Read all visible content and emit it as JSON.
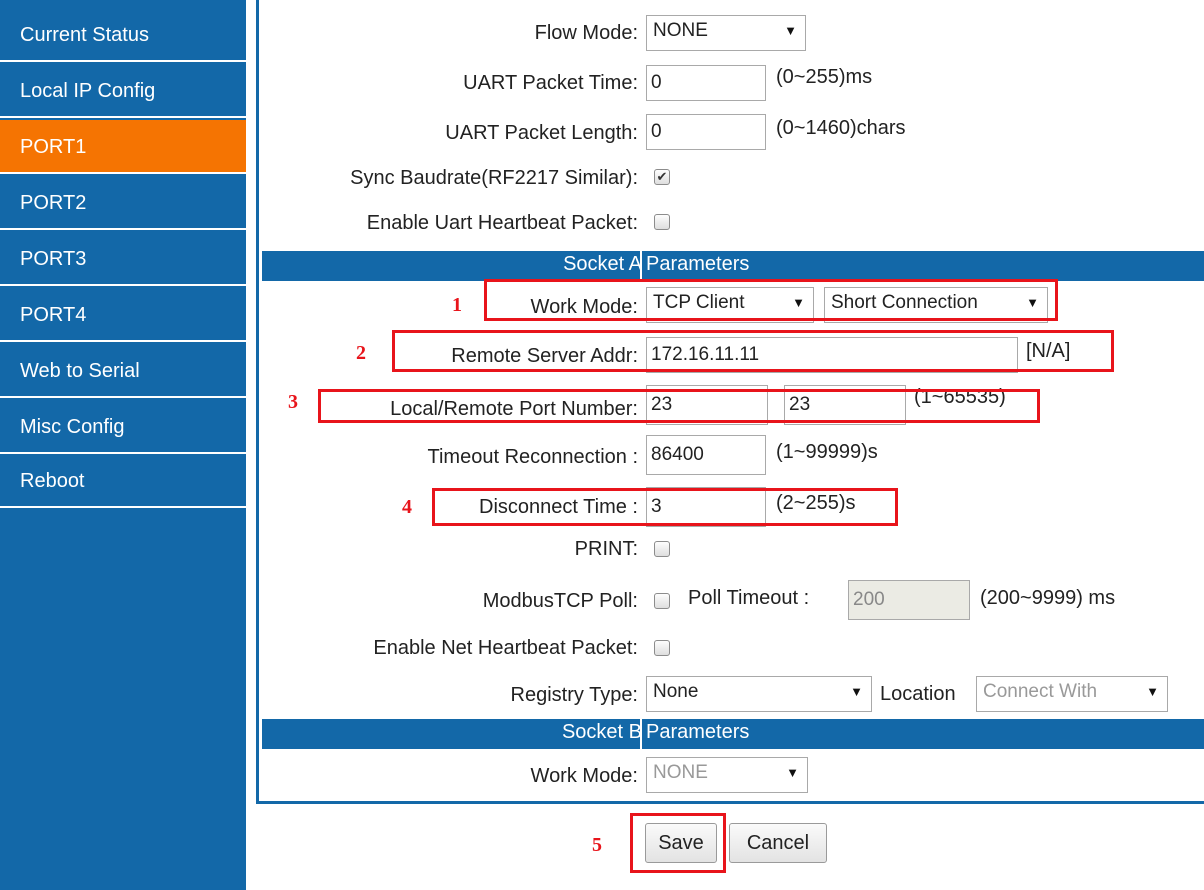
{
  "sidebar": {
    "items": [
      {
        "label": "Current Status"
      },
      {
        "label": "Local IP Config"
      },
      {
        "label": "PORT1"
      },
      {
        "label": "PORT2"
      },
      {
        "label": "PORT3"
      },
      {
        "label": "PORT4"
      },
      {
        "label": "Web to Serial"
      },
      {
        "label": "Misc Config"
      },
      {
        "label": "Reboot"
      }
    ],
    "active": "PORT1"
  },
  "form": {
    "flow_mode": {
      "label": "Flow Mode:",
      "value": "NONE"
    },
    "uart_packet_time": {
      "label": "UART Packet Time:",
      "value": "0",
      "range": "(0~255)ms"
    },
    "uart_packet_length": {
      "label": "UART Packet Length:",
      "value": "0",
      "range": "(0~1460)chars"
    },
    "sync_baudrate": {
      "label": "Sync Baudrate(RF2217 Similar):",
      "checked": true
    },
    "uart_heartbeat": {
      "label": "Enable Uart Heartbeat Packet:",
      "checked": false
    }
  },
  "socket_a": {
    "header_left": "Socket A",
    "header_right": "Parameters",
    "work_mode": {
      "label": "Work Mode:",
      "value": "TCP Client",
      "connection": "Short Connection"
    },
    "remote_server": {
      "label": "Remote Server Addr:",
      "value": "172.16.11.11",
      "note": "[N/A]"
    },
    "port_number": {
      "label": "Local/Remote Port Number:",
      "local": "23",
      "remote": "23",
      "range": "(1~65535)"
    },
    "timeout_reconnection": {
      "label": "Timeout Reconnection :",
      "value": "86400",
      "range": "(1~99999)s"
    },
    "disconnect_time": {
      "label": "Disconnect Time :",
      "value": "3",
      "range": "(2~255)s"
    },
    "print": {
      "label": "PRINT:",
      "checked": false
    },
    "modbus_poll": {
      "label": "ModbusTCP Poll:",
      "checked": false,
      "timeout_label": "Poll Timeout :",
      "timeout_value": "200",
      "range": "(200~9999) ms"
    },
    "net_heartbeat": {
      "label": "Enable Net Heartbeat Packet:",
      "checked": false
    },
    "registry": {
      "label": "Registry Type:",
      "value": "None",
      "location_label": "Location",
      "location_value": "Connect With"
    }
  },
  "socket_b": {
    "header_left": "Socket B",
    "header_right": "Parameters",
    "work_mode": {
      "label": "Work Mode:",
      "value": "NONE"
    }
  },
  "buttons": {
    "save": "Save",
    "cancel": "Cancel"
  },
  "annotations": [
    "1",
    "2",
    "3",
    "4",
    "5"
  ],
  "colors": {
    "sidebar": "#1368a8",
    "active": "#f57402",
    "highlight": "#e8141b"
  }
}
